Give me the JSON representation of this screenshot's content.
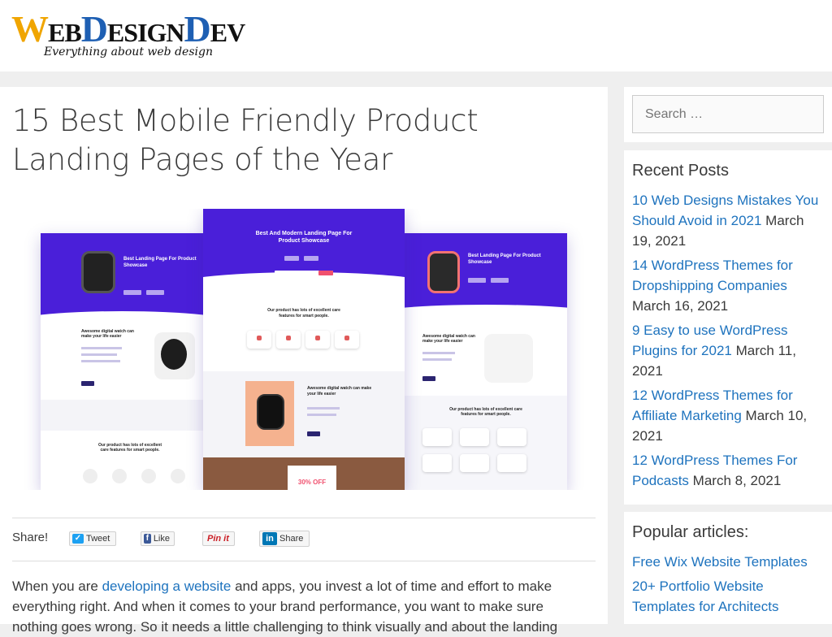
{
  "header": {
    "logo": {
      "part1": "W",
      "part2": "EB",
      "part3": "D",
      "part4": "ESIGN",
      "part5": "D",
      "part6": "EV"
    },
    "tagline": "Everything about web design"
  },
  "article": {
    "title": "15 Best Mobile Friendly Product Landing Pages of the Year",
    "featured_image": {
      "left_mock": {
        "heading": "Best Landing Page For Product Showcase",
        "section": "Awesome digital watch can make your life easier",
        "features": "Our product has lots of excellent care features for smart people."
      },
      "center_mock": {
        "heading": "Best And Modern Landing Page For Product Showcase",
        "features": "Our product has lots of excellent care features for smart people.",
        "section": "Awesome digital watch can make your life easier",
        "promo": "30% OFF"
      },
      "right_mock": {
        "heading": "Best Landing Page For Product Showcase",
        "section": "Awesome digital watch can make your life easier",
        "features": "Our product has lots of excellent care features for smart people."
      }
    },
    "share": {
      "label": "Share!",
      "tweet": "Tweet",
      "like": "Like",
      "pinit": "Pin it",
      "linkedin": "Share"
    },
    "intro": {
      "t1": "When you are ",
      "link": "developing a website",
      "t2": " and apps, you invest a lot of time and effort to make everything right. And when it comes to your brand performance, you want to make sure nothing goes wrong. So it needs a little challenging to think visually ",
      "t3": "and about the landing"
    }
  },
  "sidebar": {
    "search": {
      "placeholder": "Search …"
    },
    "recent": {
      "title": "Recent Posts",
      "items": [
        {
          "link": "10 Web Designs Mistakes You Should Avoid in 2021",
          "date": "March 19, 2021"
        },
        {
          "link": "14 WordPress Themes for Dropshipping Companies",
          "date": "March 16, 2021"
        },
        {
          "link": "9 Easy to use WordPress Plugins for 2021",
          "date": "March 11, 2021"
        },
        {
          "link": "12 WordPress Themes for Affiliate Marketing",
          "date": "March 10, 2021"
        },
        {
          "link": "12 WordPress Themes For Podcasts",
          "date": "March 8, 2021"
        }
      ]
    },
    "popular": {
      "title": "Popular articles:",
      "items": [
        {
          "link": "Free Wix Website Templates"
        },
        {
          "link": "20+ Portfolio Website Templates for Architects"
        }
      ]
    }
  },
  "colors": {
    "link": "#1e73be",
    "text": "#3a3a3a",
    "logo_orange": "#f0a500",
    "logo_blue": "#1e5fb3",
    "hero_purple": "#4a1fd9"
  }
}
